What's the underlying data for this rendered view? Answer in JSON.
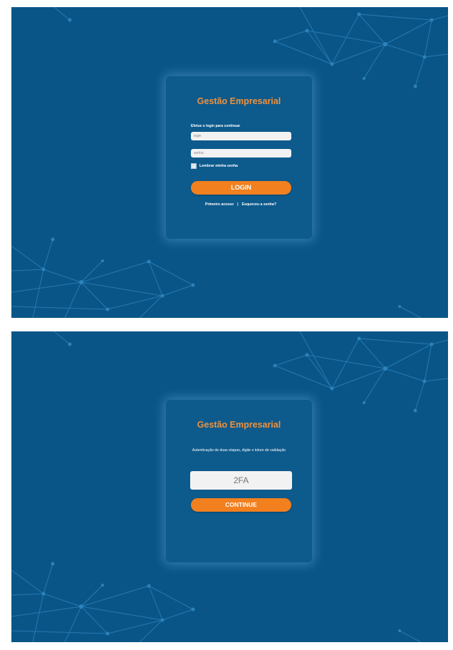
{
  "colors": {
    "background": "#0a5588",
    "card": "#0d5a8c",
    "accent": "#f2801f",
    "title": "#f0913a",
    "network_lines": "#2f86bf"
  },
  "login_screen": {
    "title": "Gestão Empresarial",
    "instruction": "Efetue o login para continuar",
    "login_placeholder": "login",
    "password_placeholder": "senha",
    "remember_label": "Lembrar minha senha",
    "remember_checked": false,
    "login_button": "LOGIN",
    "first_access_link": "Primeiro acesso",
    "separator": "|",
    "forgot_password_link": "Esqueceu a senha?"
  },
  "twofa_screen": {
    "title": "Gestão Empresarial",
    "instruction": "Autenticação de duas etapas, digite o token de validação",
    "token_placeholder": "2FA",
    "continue_button": "CONTINUE"
  }
}
